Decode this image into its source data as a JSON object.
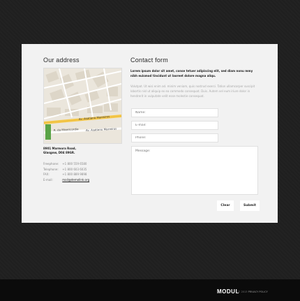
{
  "address": {
    "heading": "Our address",
    "street": "8901 Marmora Road,",
    "city": "Glasgow, D04 89GR.",
    "contacts": [
      {
        "label": "Freephone:",
        "value": "+1 800 559 6580"
      },
      {
        "label": "Telephone:",
        "value": "+1 800 603 6035"
      },
      {
        "label": "FAX:",
        "value": "+1 800 889 9898"
      },
      {
        "label": "E-mail:",
        "value": "mail@demolink.org"
      }
    ]
  },
  "map": {
    "street_labels": [
      "Av. Asatiano Marreiros",
      "R. da Misericordia",
      "Av. Asatiano Marreiros"
    ]
  },
  "contact": {
    "heading": "Contact form",
    "lead": "Lorem ipsum dolor sit amet, conse tetuer adipiscing elit, sed diam nonu mmy nibh euismod tincidunt ut laoreet dolore magna aliqu.",
    "body": "Volutpat. Ut wisi enim ad. minim veniam, quis nostrud exerci. Tation ullamcorper suscipit lobortis nisl ut aliquip ex ea commodo consequat. Duis. Autem vel eum iriure dolor in hendrerit in vulputate velit esse molestie consequat.",
    "name_placeholder": "Name:",
    "email_placeholder": "E-mail:",
    "phone_placeholder": "Phone:",
    "message_placeholder": "Message:",
    "clear_label": "Clear",
    "submit_label": "Submit"
  },
  "footer": {
    "logo": "MODUL",
    "copyright": "© 2013",
    "privacy": "PRIVACY POLICY"
  }
}
